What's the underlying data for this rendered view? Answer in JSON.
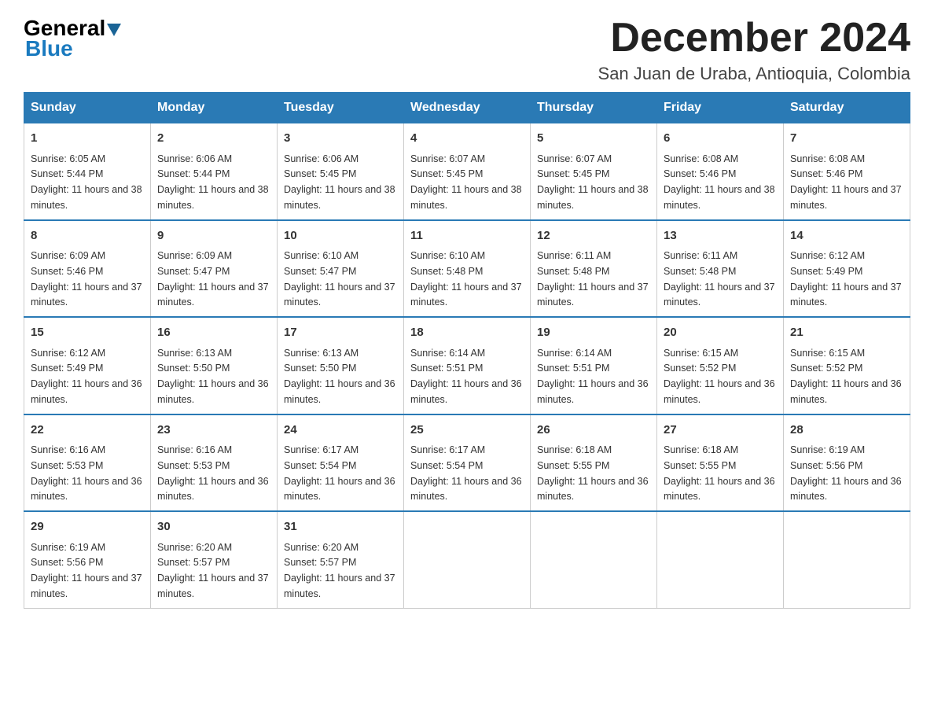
{
  "logo": {
    "general": "General",
    "blue": "Blue"
  },
  "title": "December 2024",
  "location": "San Juan de Uraba, Antioquia, Colombia",
  "days_of_week": [
    "Sunday",
    "Monday",
    "Tuesday",
    "Wednesday",
    "Thursday",
    "Friday",
    "Saturday"
  ],
  "weeks": [
    [
      {
        "day": "1",
        "sunrise": "Sunrise: 6:05 AM",
        "sunset": "Sunset: 5:44 PM",
        "daylight": "Daylight: 11 hours and 38 minutes."
      },
      {
        "day": "2",
        "sunrise": "Sunrise: 6:06 AM",
        "sunset": "Sunset: 5:44 PM",
        "daylight": "Daylight: 11 hours and 38 minutes."
      },
      {
        "day": "3",
        "sunrise": "Sunrise: 6:06 AM",
        "sunset": "Sunset: 5:45 PM",
        "daylight": "Daylight: 11 hours and 38 minutes."
      },
      {
        "day": "4",
        "sunrise": "Sunrise: 6:07 AM",
        "sunset": "Sunset: 5:45 PM",
        "daylight": "Daylight: 11 hours and 38 minutes."
      },
      {
        "day": "5",
        "sunrise": "Sunrise: 6:07 AM",
        "sunset": "Sunset: 5:45 PM",
        "daylight": "Daylight: 11 hours and 38 minutes."
      },
      {
        "day": "6",
        "sunrise": "Sunrise: 6:08 AM",
        "sunset": "Sunset: 5:46 PM",
        "daylight": "Daylight: 11 hours and 38 minutes."
      },
      {
        "day": "7",
        "sunrise": "Sunrise: 6:08 AM",
        "sunset": "Sunset: 5:46 PM",
        "daylight": "Daylight: 11 hours and 37 minutes."
      }
    ],
    [
      {
        "day": "8",
        "sunrise": "Sunrise: 6:09 AM",
        "sunset": "Sunset: 5:46 PM",
        "daylight": "Daylight: 11 hours and 37 minutes."
      },
      {
        "day": "9",
        "sunrise": "Sunrise: 6:09 AM",
        "sunset": "Sunset: 5:47 PM",
        "daylight": "Daylight: 11 hours and 37 minutes."
      },
      {
        "day": "10",
        "sunrise": "Sunrise: 6:10 AM",
        "sunset": "Sunset: 5:47 PM",
        "daylight": "Daylight: 11 hours and 37 minutes."
      },
      {
        "day": "11",
        "sunrise": "Sunrise: 6:10 AM",
        "sunset": "Sunset: 5:48 PM",
        "daylight": "Daylight: 11 hours and 37 minutes."
      },
      {
        "day": "12",
        "sunrise": "Sunrise: 6:11 AM",
        "sunset": "Sunset: 5:48 PM",
        "daylight": "Daylight: 11 hours and 37 minutes."
      },
      {
        "day": "13",
        "sunrise": "Sunrise: 6:11 AM",
        "sunset": "Sunset: 5:48 PM",
        "daylight": "Daylight: 11 hours and 37 minutes."
      },
      {
        "day": "14",
        "sunrise": "Sunrise: 6:12 AM",
        "sunset": "Sunset: 5:49 PM",
        "daylight": "Daylight: 11 hours and 37 minutes."
      }
    ],
    [
      {
        "day": "15",
        "sunrise": "Sunrise: 6:12 AM",
        "sunset": "Sunset: 5:49 PM",
        "daylight": "Daylight: 11 hours and 36 minutes."
      },
      {
        "day": "16",
        "sunrise": "Sunrise: 6:13 AM",
        "sunset": "Sunset: 5:50 PM",
        "daylight": "Daylight: 11 hours and 36 minutes."
      },
      {
        "day": "17",
        "sunrise": "Sunrise: 6:13 AM",
        "sunset": "Sunset: 5:50 PM",
        "daylight": "Daylight: 11 hours and 36 minutes."
      },
      {
        "day": "18",
        "sunrise": "Sunrise: 6:14 AM",
        "sunset": "Sunset: 5:51 PM",
        "daylight": "Daylight: 11 hours and 36 minutes."
      },
      {
        "day": "19",
        "sunrise": "Sunrise: 6:14 AM",
        "sunset": "Sunset: 5:51 PM",
        "daylight": "Daylight: 11 hours and 36 minutes."
      },
      {
        "day": "20",
        "sunrise": "Sunrise: 6:15 AM",
        "sunset": "Sunset: 5:52 PM",
        "daylight": "Daylight: 11 hours and 36 minutes."
      },
      {
        "day": "21",
        "sunrise": "Sunrise: 6:15 AM",
        "sunset": "Sunset: 5:52 PM",
        "daylight": "Daylight: 11 hours and 36 minutes."
      }
    ],
    [
      {
        "day": "22",
        "sunrise": "Sunrise: 6:16 AM",
        "sunset": "Sunset: 5:53 PM",
        "daylight": "Daylight: 11 hours and 36 minutes."
      },
      {
        "day": "23",
        "sunrise": "Sunrise: 6:16 AM",
        "sunset": "Sunset: 5:53 PM",
        "daylight": "Daylight: 11 hours and 36 minutes."
      },
      {
        "day": "24",
        "sunrise": "Sunrise: 6:17 AM",
        "sunset": "Sunset: 5:54 PM",
        "daylight": "Daylight: 11 hours and 36 minutes."
      },
      {
        "day": "25",
        "sunrise": "Sunrise: 6:17 AM",
        "sunset": "Sunset: 5:54 PM",
        "daylight": "Daylight: 11 hours and 36 minutes."
      },
      {
        "day": "26",
        "sunrise": "Sunrise: 6:18 AM",
        "sunset": "Sunset: 5:55 PM",
        "daylight": "Daylight: 11 hours and 36 minutes."
      },
      {
        "day": "27",
        "sunrise": "Sunrise: 6:18 AM",
        "sunset": "Sunset: 5:55 PM",
        "daylight": "Daylight: 11 hours and 36 minutes."
      },
      {
        "day": "28",
        "sunrise": "Sunrise: 6:19 AM",
        "sunset": "Sunset: 5:56 PM",
        "daylight": "Daylight: 11 hours and 36 minutes."
      }
    ],
    [
      {
        "day": "29",
        "sunrise": "Sunrise: 6:19 AM",
        "sunset": "Sunset: 5:56 PM",
        "daylight": "Daylight: 11 hours and 37 minutes."
      },
      {
        "day": "30",
        "sunrise": "Sunrise: 6:20 AM",
        "sunset": "Sunset: 5:57 PM",
        "daylight": "Daylight: 11 hours and 37 minutes."
      },
      {
        "day": "31",
        "sunrise": "Sunrise: 6:20 AM",
        "sunset": "Sunset: 5:57 PM",
        "daylight": "Daylight: 11 hours and 37 minutes."
      },
      null,
      null,
      null,
      null
    ]
  ]
}
